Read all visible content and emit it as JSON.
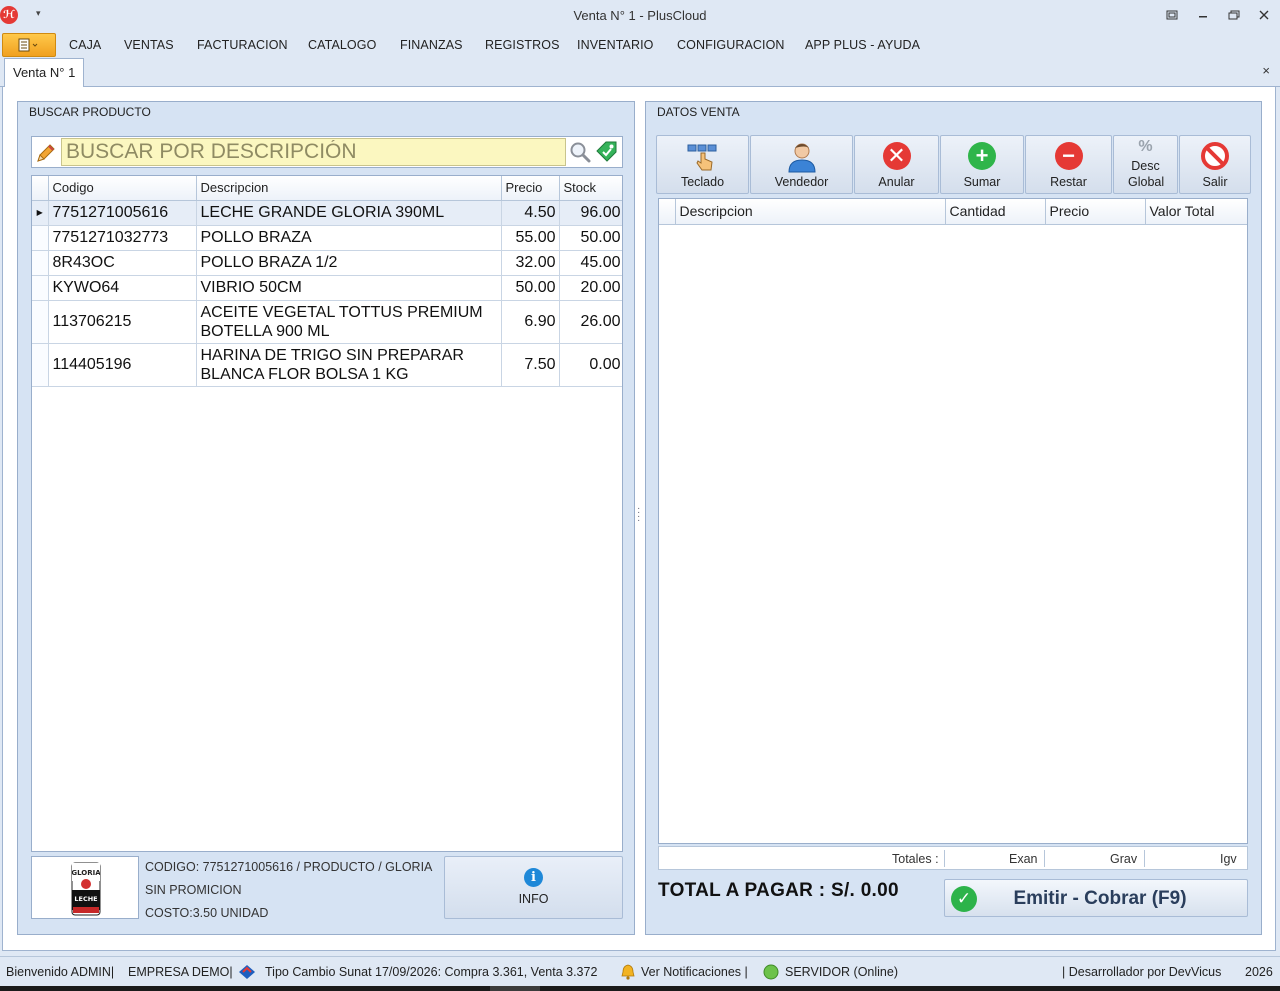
{
  "window": {
    "title": "Venta N° 1 - PlusCloud",
    "controls": [
      "restore-size",
      "minimize",
      "maximize",
      "close"
    ]
  },
  "menu": {
    "items": [
      "CAJA",
      "VENTAS",
      "FACTURACION",
      "CATALOGO",
      "FINANZAS",
      "REGISTROS",
      "INVENTARIO",
      "CONFIGURACION",
      "APP PLUS - AYUDA"
    ]
  },
  "doc_tab": {
    "label": "Venta N° 1",
    "close": "×"
  },
  "left_panel": {
    "title": "BUSCAR PRODUCTO",
    "search_placeholder": "BUSCAR POR DESCRIPCIÓN",
    "columns": [
      "Codigo",
      "Descripcion",
      "Precio",
      "Stock"
    ],
    "rows": [
      {
        "codigo": "7751271005616",
        "descripcion": "LECHE GRANDE GLORIA 390ML",
        "precio": "4.50",
        "stock": "96.00",
        "selected": true
      },
      {
        "codigo": "7751271032773",
        "descripcion": "POLLO BRAZA",
        "precio": "55.00",
        "stock": "50.00"
      },
      {
        "codigo": "8R43OC",
        "descripcion": "POLLO BRAZA 1/2",
        "precio": "32.00",
        "stock": "45.00"
      },
      {
        "codigo": "KYWO64",
        "descripcion": "VIBRIO 50CM",
        "precio": "50.00",
        "stock": "20.00"
      },
      {
        "codigo": "113706215",
        "descripcion": "ACEITE VEGETAL TOTTUS PREMIUM BOTELLA 900 ML",
        "precio": "6.90",
        "stock": "26.00"
      },
      {
        "codigo": "114405196",
        "descripcion": "HARINA DE TRIGO SIN PREPARAR BLANCA FLOR BOLSA 1 KG",
        "precio": "7.50",
        "stock": "0.00"
      }
    ],
    "product_info": {
      "image_brand": "GLORIA",
      "image_sub": "LECHE",
      "line1": "CODIGO: 7751271005616 / PRODUCTO / GLORIA",
      "line2": "SIN PROMICION",
      "line3": "COSTO:3.50 UNIDAD"
    },
    "info_button": {
      "icon": "i",
      "label": "INFO"
    }
  },
  "right_panel": {
    "title": "DATOS VENTA",
    "toolbar": [
      {
        "key": "teclado",
        "label": "Teclado",
        "icon": "keyboard-hand-icon"
      },
      {
        "key": "vendedor",
        "label": "Vendedor",
        "icon": "user-icon"
      },
      {
        "key": "anular",
        "label": "Anular",
        "icon": "x-circle-icon",
        "color": "#e53935",
        "glyph": "✕"
      },
      {
        "key": "sumar",
        "label": "Sumar",
        "icon": "plus-circle-icon",
        "color": "#2fb54a",
        "glyph": "+"
      },
      {
        "key": "restar",
        "label": "Restar",
        "icon": "minus-circle-icon",
        "color": "#e53935",
        "glyph": "−"
      },
      {
        "key": "desc",
        "label": "Desc Global",
        "icon": "percent-icon",
        "glyph": "%"
      },
      {
        "key": "salir",
        "label": "Salir",
        "icon": "no-entry-icon",
        "color": "#e53935"
      }
    ],
    "columns": [
      "Descripcion",
      "Cantidad",
      "Precio",
      "Valor Total"
    ],
    "totals": {
      "label": "Totales :",
      "exan": "Exan",
      "grav": "Grav",
      "igv": "Igv"
    },
    "total_pagar": "TOTAL A PAGAR  : S/.  0.00",
    "emit_button": "Emitir - Cobrar (F9)"
  },
  "statusbar": {
    "welcome": "Bienvenido ADMIN|",
    "empresa": "EMPRESA DEMO|",
    "tipo_cambio": "Tipo Cambio Sunat 17/09/2026: Compra 3.361, Venta 3.372",
    "notificaciones": "Ver Notificaciones |",
    "servidor": "SERVIDOR (Online)",
    "developer": "| Desarrollador por DevVicus",
    "year": "2026"
  },
  "colors": {
    "accent_orange": "#f0a020",
    "panel_bg": "#d6e3f3",
    "search_bg": "#fbf7c0",
    "red": "#e53935",
    "green": "#2fb54a",
    "blue": "#1e88d8"
  }
}
